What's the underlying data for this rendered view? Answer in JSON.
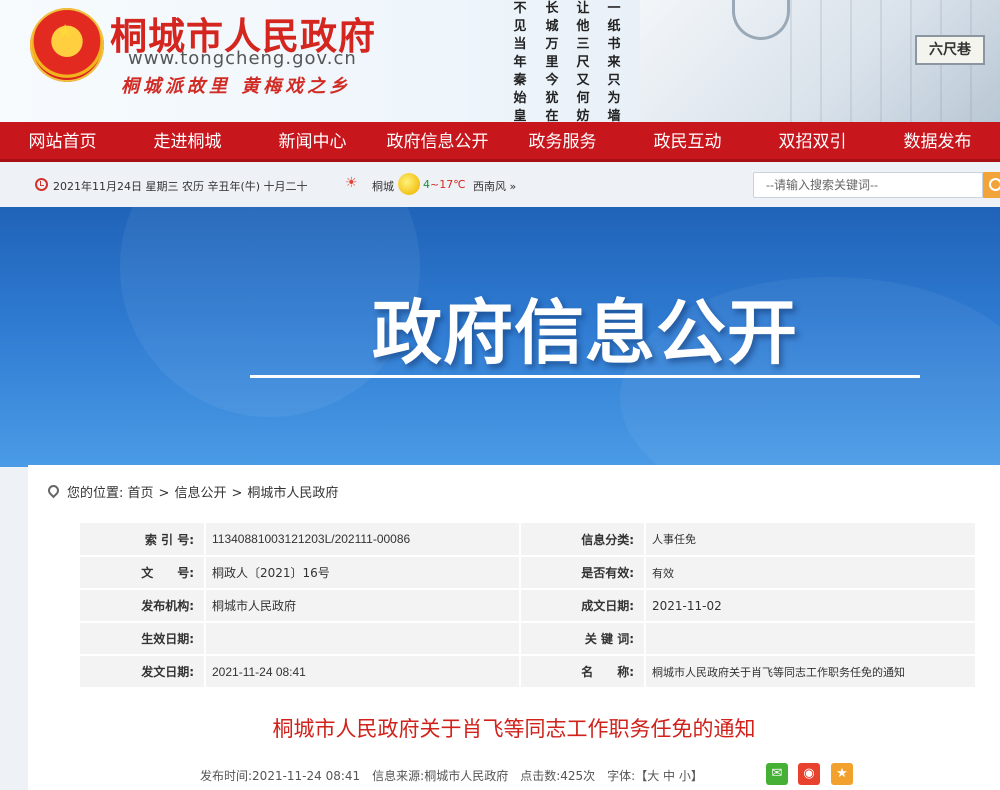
{
  "header": {
    "title": "桐城市人民政府",
    "url": "www.tongcheng.gov.cn",
    "slogan": "桐城派故里 黄梅戏之乡",
    "poem_columns": [
      "不见当年秦始皇",
      "长城万里今犹在",
      "让他三尺又何妨",
      "一纸书来只为墙"
    ],
    "plaque": "六尺巷"
  },
  "nav": {
    "items": [
      "网站首页",
      "走进桐城",
      "新闻中心",
      "政府信息公开",
      "政务服务",
      "政民互动",
      "双招双引",
      "数据发布"
    ]
  },
  "infobar": {
    "date": "2021年11月24日 星期三 农历 辛丑年(牛) 十月二十",
    "city": "桐城",
    "temp_low": "4",
    "temp_high": "~17℃",
    "wind": "西南风 »",
    "search_placeholder": "--请输入搜索关键词--"
  },
  "banner": {
    "title": "政府信息公开"
  },
  "breadcrumb": {
    "prefix": "您的位置:",
    "items": [
      "首页",
      "信息公开",
      "桐城市人民政府"
    ]
  },
  "meta": {
    "index_label": "索 引 号:",
    "index_value": "11340881003121203L/202111-00086",
    "category_label": "信息分类:",
    "category_value": "人事任免",
    "docno_label": "文　　号:",
    "docno_value": "桐政人〔2021〕16号",
    "valid_label": "是否有效:",
    "valid_value": "有效",
    "publisher_label": "发布机构:",
    "publisher_value": "桐城市人民政府",
    "created_label": "成文日期:",
    "created_value": "2021-11-02",
    "effective_label": "生效日期:",
    "effective_value": "",
    "keywords_label": "关 键 词:",
    "keywords_value": "",
    "issued_label": "发文日期:",
    "issued_value": "2021-11-24 08:41",
    "name_label": "名　　称:",
    "name_value": "桐城市人民政府关于肖飞等同志工作职务任免的通知"
  },
  "article": {
    "title": "桐城市人民政府关于肖飞等同志工作职务任免的通知",
    "info": "发布时间:2021-11-24 08:41　信息来源:桐城市人民政府　点击数:425次　字体:【大 中 小】"
  },
  "colors": {
    "nav_red": "#c8161d",
    "title_red": "#d0221a",
    "banner_blue": "#2f7bd2"
  }
}
